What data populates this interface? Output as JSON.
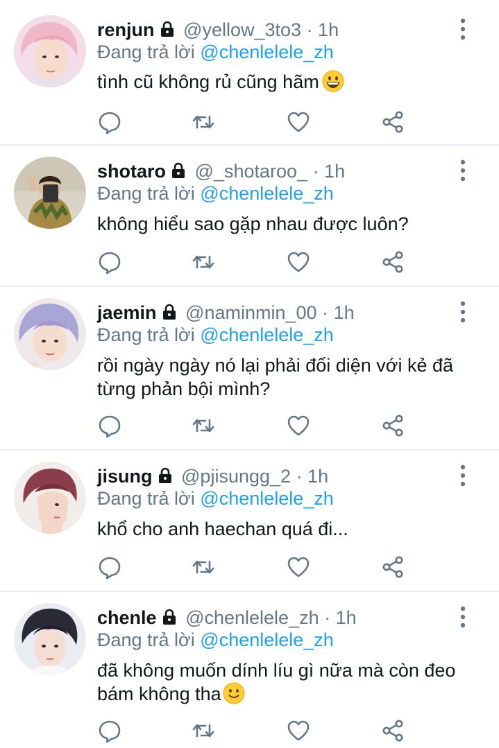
{
  "reply_prefix": "Đang trả lời",
  "colors": {
    "link": "#1da1f2",
    "secondary": "#657786",
    "text": "#14171a",
    "divider": "#e6ecf0"
  },
  "tweets": [
    {
      "name": "renjun",
      "handle": "@yellow_3to3",
      "time": "· 1h",
      "reply_to": "@chenlelele_zh",
      "text": "tình cũ không rủ cũng hãm",
      "emoji": "grinning-face-emoji",
      "avatar": "avatar-renjun"
    },
    {
      "name": "shotaro",
      "handle": "@_shotaroo_",
      "time": "· 1h",
      "reply_to": "@chenlelele_zh",
      "text": "không hiểu sao gặp nhau được luôn?",
      "avatar": "avatar-shotaro"
    },
    {
      "name": "jaemin",
      "handle": "@naminmin_00",
      "time": "· 1h",
      "reply_to": "@chenlelele_zh",
      "text": "rồi ngày ngày nó lại phải đối diện với kẻ đã từng phản bội mình?",
      "avatar": "avatar-jaemin"
    },
    {
      "name": "jisung",
      "handle": "@pjisungg_2",
      "time": "· 1h",
      "reply_to": "@chenlelele_zh",
      "text": "khổ cho anh haechan quá đi...",
      "avatar": "avatar-jisung"
    },
    {
      "name": "chenle",
      "handle": "@chenlelele_zh",
      "time": "· 1h",
      "reply_to": "@chenlelele_zh",
      "text": "đã không muốn dính líu gì nữa mà còn đeo bám không tha",
      "emoji": "slightly-smiling-face-emoji",
      "avatar": "avatar-chenle"
    }
  ],
  "icons": [
    "lock-icon",
    "more-vertical-icon",
    "reply-icon",
    "retweet-icon",
    "like-icon",
    "share-icon"
  ]
}
